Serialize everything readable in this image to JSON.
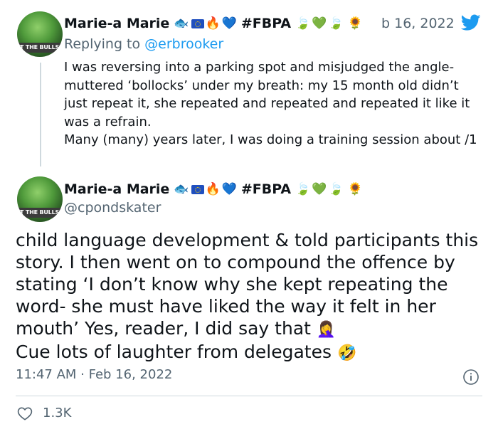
{
  "tweet1": {
    "avatar_text": "ST THE BULLSH",
    "name": "Marie-a Marie",
    "tag": "#FBPA",
    "date_partial": "b 16, 2022",
    "reply_prefix": "Replying to ",
    "reply_handle": "@erbrooker",
    "body": [
      "I was reversing into a parking spot and misjudged the angle- muttered ‘bollocks’ under my breath: my 15 month old didn’t just repeat it, she repeated and repeated and repeated it like it was a refrain.",
      "Many (many) years later, I was doing a training session about /1"
    ]
  },
  "tweet2": {
    "avatar_text": "ST THE BULLSH",
    "name": "Marie-a Marie",
    "tag": "#FBPA",
    "handle": "@cpondskater",
    "body_lines": [
      "child language development & told participants this story. I then went on to compound the offence by stating ‘I don’t know why she kept repeating the word- she must have liked the way it felt in her mouth’ Yes, reader, I did say that",
      "Cue lots of laughter from delegates"
    ],
    "emoji_1": "🤦‍♀️",
    "emoji_2": "🤣",
    "time": "11:47 AM · Feb 16, 2022",
    "likes": "1.3K"
  },
  "icons": {
    "twitter_logo": "twitter-bird-icon",
    "info": "info-icon",
    "like": "heart-outline-icon"
  },
  "colors": {
    "accent": "#1d9bf0",
    "muted": "#536471",
    "divider": "#cfd9de"
  }
}
